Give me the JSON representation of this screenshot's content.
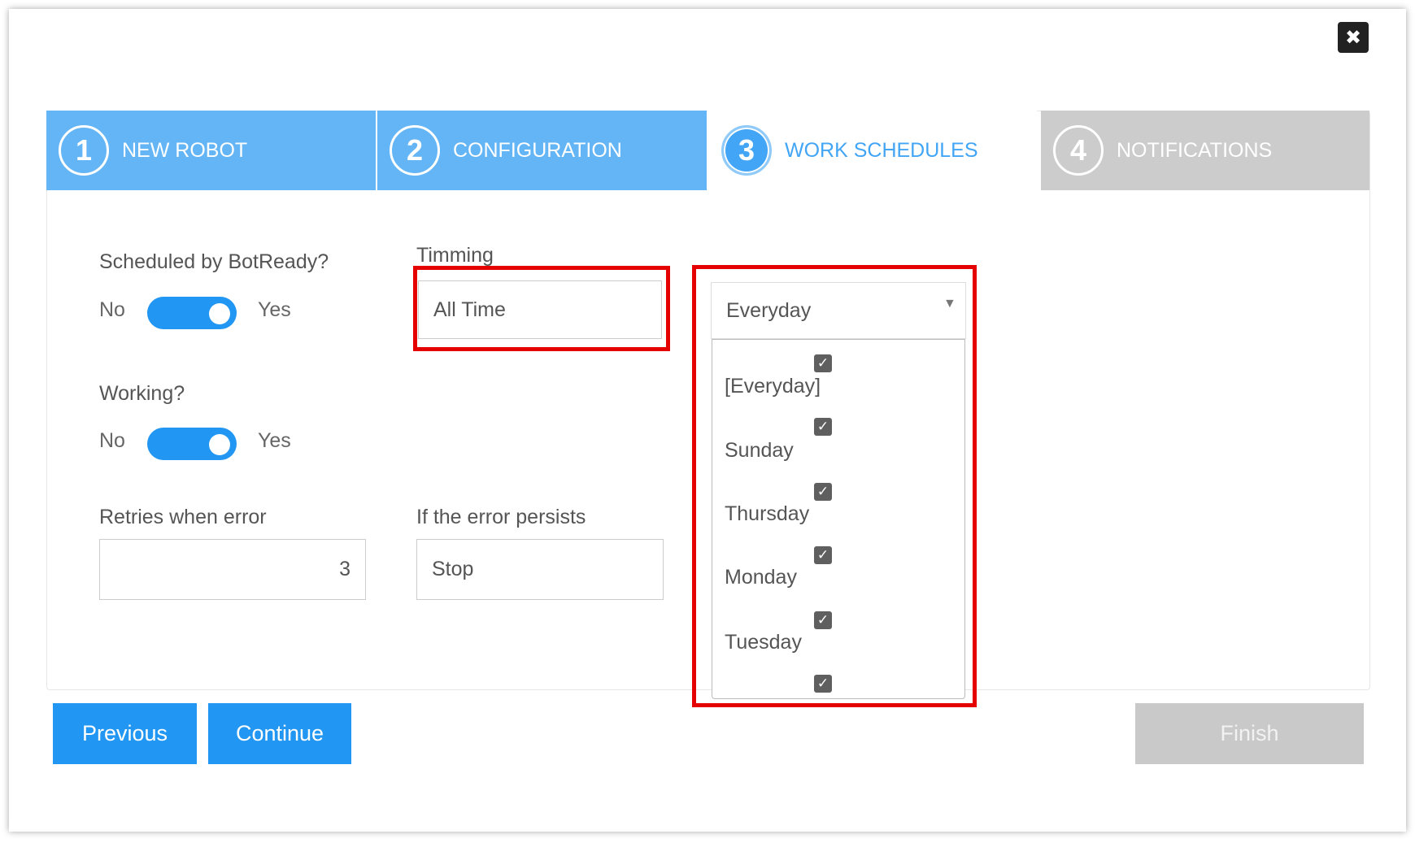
{
  "steps": [
    {
      "number": "1",
      "label": "NEW ROBOT"
    },
    {
      "number": "2",
      "label": "CONFIGURATION"
    },
    {
      "number": "3",
      "label": "WORK SCHEDULES"
    },
    {
      "number": "4",
      "label": "NOTIFICATIONS"
    }
  ],
  "form": {
    "scheduled_label": "Scheduled by BotReady?",
    "working_label": "Working?",
    "no_label": "No",
    "yes_label": "Yes",
    "timming_label": "Timming",
    "timming_value": "All Time",
    "schedule_select_value": "Everyday",
    "retries_label": "Retries when error",
    "retries_value": "3",
    "persist_label": "If the error persists",
    "persist_value": "Stop"
  },
  "dropdown": {
    "options": [
      "[Everyday]",
      "Sunday",
      "Thursday",
      "Monday",
      "Tuesday"
    ]
  },
  "buttons": {
    "previous": "Previous",
    "continue": "Continue",
    "finish": "Finish",
    "close": "✖"
  },
  "colors": {
    "accent": "#2196f3",
    "step_active_bg": "#64b5f6",
    "step_inactive_bg": "#cccccc",
    "highlight": "#e50000"
  }
}
